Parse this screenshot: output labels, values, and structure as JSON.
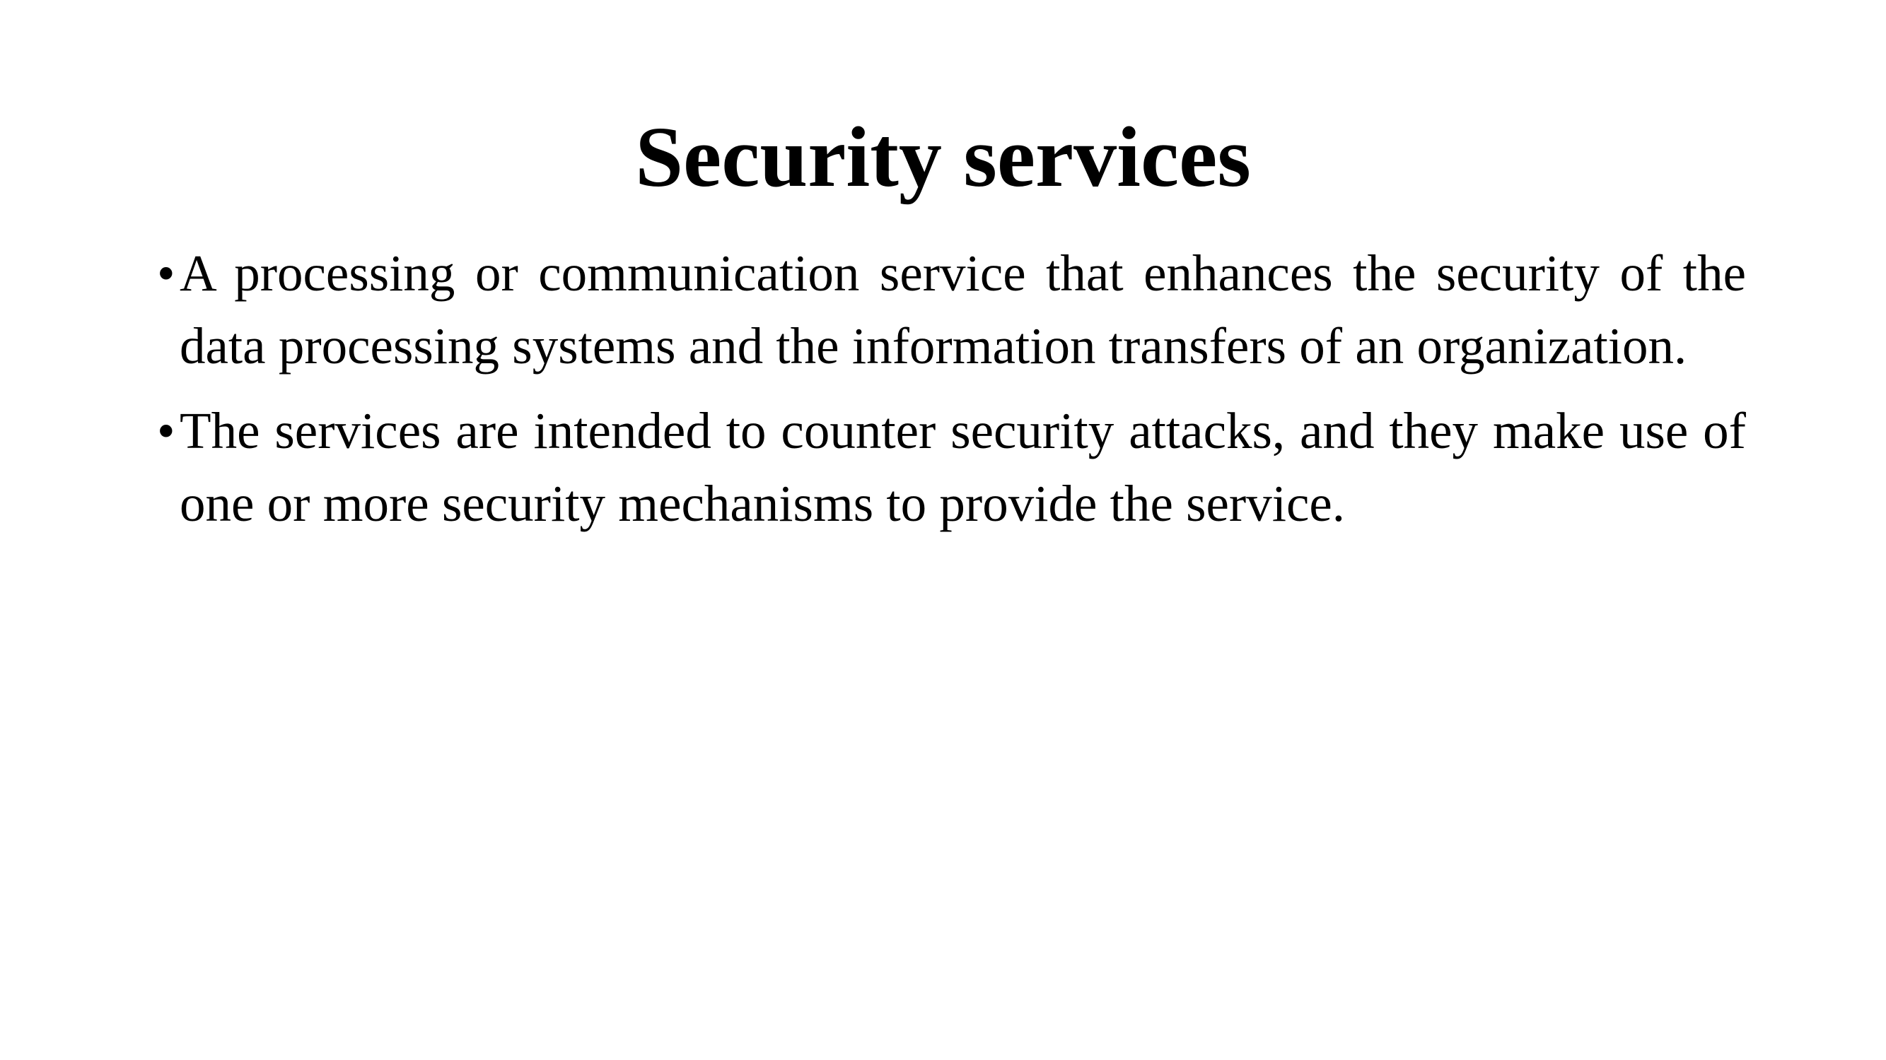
{
  "slide": {
    "title": "Security services",
    "bullet_marker": "•",
    "bullets": [
      "A processing or communication service that enhances the security of the data processing systems and the information transfers of an organization.",
      "The services are intended to counter security attacks, and they make use of one or more security mechanisms to provide the service."
    ]
  }
}
